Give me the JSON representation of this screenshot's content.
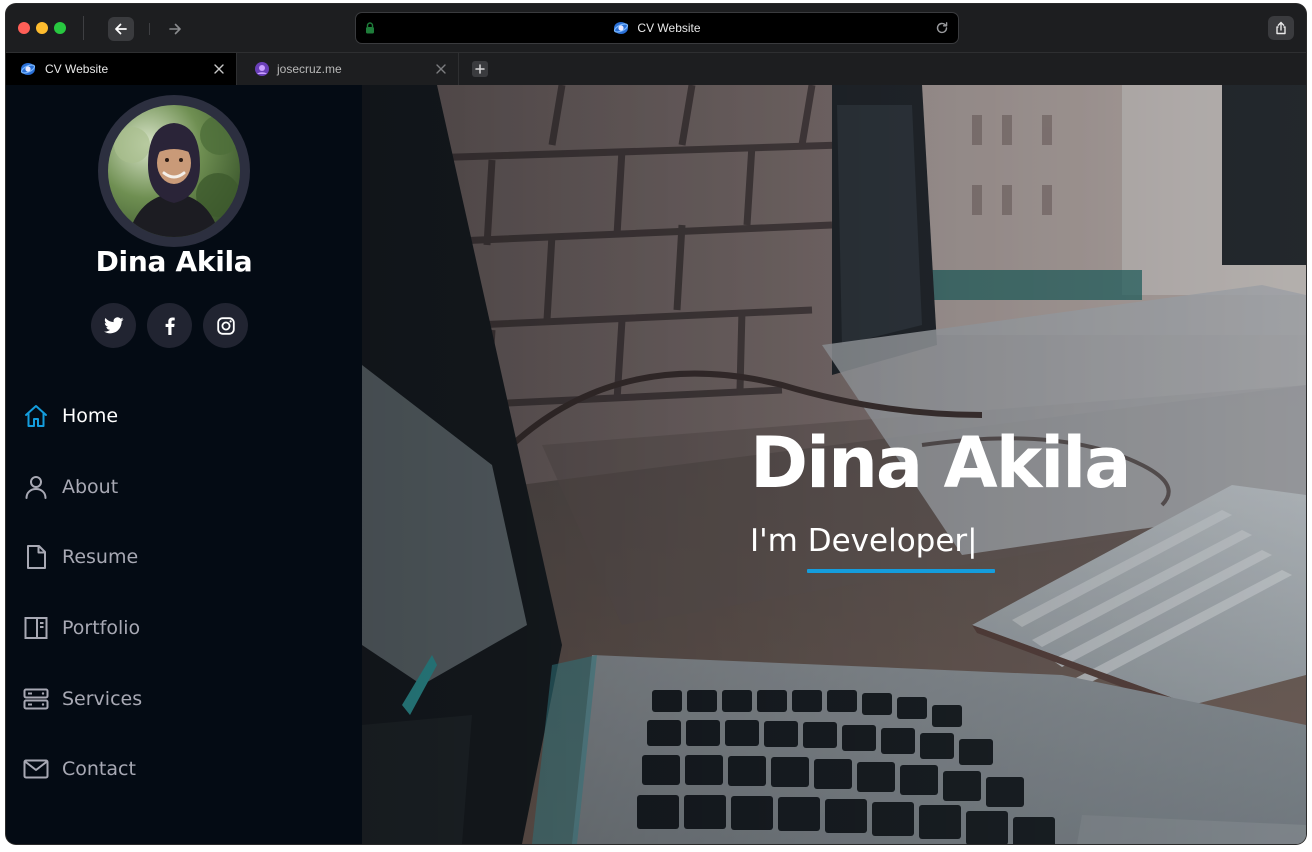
{
  "browser": {
    "url_text": "CV Website",
    "tabs": [
      {
        "title": "CV Website",
        "active": true
      },
      {
        "title": "josecruz.me",
        "active": false
      }
    ],
    "new_tab_icon": "plus-icon"
  },
  "profile": {
    "name": "Dina Akila",
    "socials": [
      "twitter-icon",
      "facebook-icon",
      "instagram-icon"
    ]
  },
  "nav": {
    "items": [
      {
        "label": "Home",
        "icon": "home-icon",
        "active": true
      },
      {
        "label": "About",
        "icon": "user-icon",
        "active": false
      },
      {
        "label": "Resume",
        "icon": "file-icon",
        "active": false
      },
      {
        "label": "Portfolio",
        "icon": "book-icon",
        "active": false
      },
      {
        "label": "Services",
        "icon": "server-icon",
        "active": false
      },
      {
        "label": "Contact",
        "icon": "envelope-icon",
        "active": false
      }
    ]
  },
  "hero": {
    "title": "Dina Akila",
    "prefix": "I'm ",
    "typed": "Developer",
    "cursor": "|"
  },
  "colors": {
    "sidebar_bg": "#040b14",
    "accent": "#149ddd",
    "social_bg": "#212431"
  }
}
